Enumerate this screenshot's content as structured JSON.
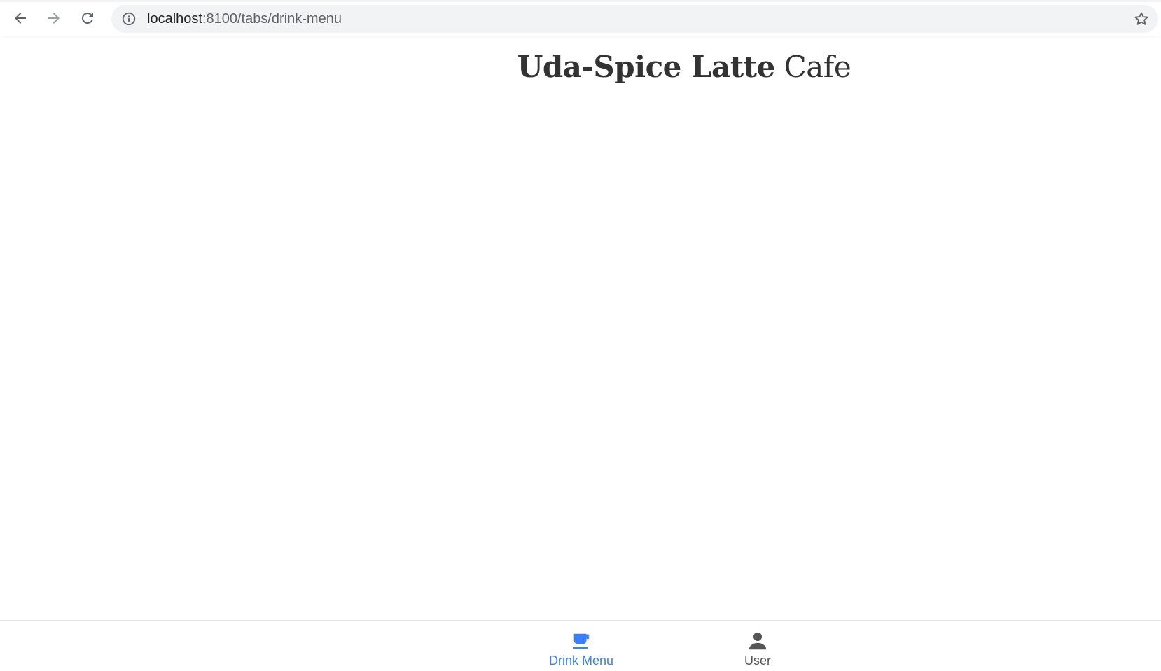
{
  "browser": {
    "url_host": "localhost",
    "url_path": ":8100/tabs/drink-menu"
  },
  "header": {
    "title_bold": "Uda-Spice Latte",
    "title_light": " Cafe"
  },
  "tabs": [
    {
      "label": "Drink Menu",
      "icon": "cafe-icon",
      "selected": true
    },
    {
      "label": "User",
      "icon": "person-icon",
      "selected": false
    }
  ],
  "colors": {
    "accent": "#3880ff",
    "tab_inactive": "#555555",
    "title": "#333333"
  }
}
